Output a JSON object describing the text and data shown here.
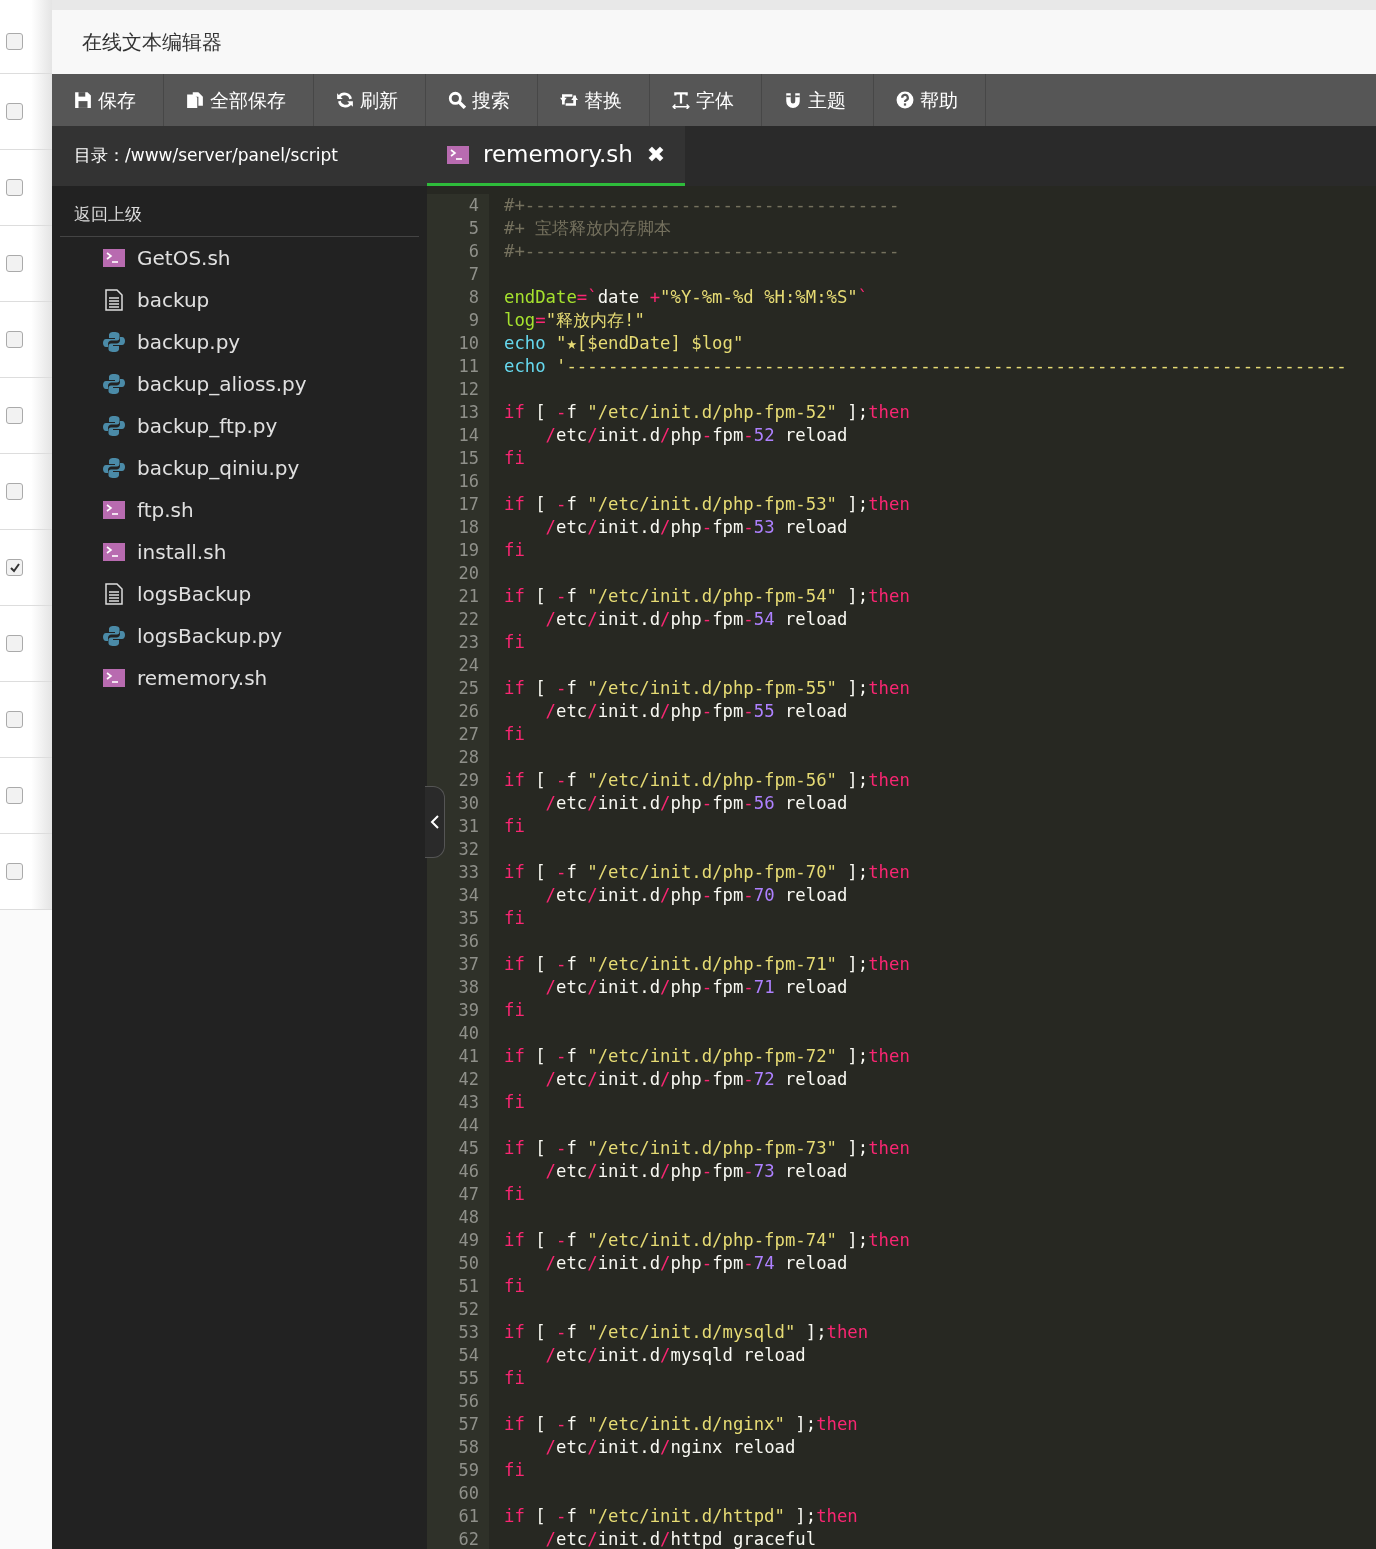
{
  "background_rows": [
    {
      "checked": false
    },
    {
      "checked": false
    },
    {
      "checked": false
    },
    {
      "checked": false
    },
    {
      "checked": false
    },
    {
      "checked": false
    },
    {
      "checked": false
    },
    {
      "checked": true
    },
    {
      "checked": false
    },
    {
      "checked": false
    },
    {
      "checked": false
    },
    {
      "checked": false
    }
  ],
  "window": {
    "title": "在线文本编辑器"
  },
  "toolbar": [
    {
      "kind": "save",
      "label": "保存"
    },
    {
      "kind": "copy",
      "label": "全部保存"
    },
    {
      "kind": "refresh",
      "label": "刷新"
    },
    {
      "kind": "search",
      "label": "搜索"
    },
    {
      "kind": "replace",
      "label": "替换"
    },
    {
      "kind": "font",
      "label": "字体"
    },
    {
      "kind": "magnet",
      "label": "主题"
    },
    {
      "kind": "help",
      "label": "帮助"
    }
  ],
  "sidebar": {
    "directory": "目录：/www/server/panel/script",
    "back": "返回上级",
    "files": [
      {
        "name": "GetOS.sh",
        "kind": "shell"
      },
      {
        "name": "backup",
        "kind": "text"
      },
      {
        "name": "backup.py",
        "kind": "python"
      },
      {
        "name": "backup_alioss.py",
        "kind": "python"
      },
      {
        "name": "backup_ftp.py",
        "kind": "python"
      },
      {
        "name": "backup_qiniu.py",
        "kind": "python"
      },
      {
        "name": "ftp.sh",
        "kind": "shell"
      },
      {
        "name": "install.sh",
        "kind": "shell"
      },
      {
        "name": "logsBackup",
        "kind": "text"
      },
      {
        "name": "logsBackup.py",
        "kind": "python"
      },
      {
        "name": "rememory.sh",
        "kind": "shell"
      }
    ]
  },
  "tabs": [
    {
      "label": "rememory.sh",
      "kind": "shell",
      "selected": true,
      "close": "✖"
    }
  ],
  "code_lines": [
    {
      "number": "4",
      "tokens": [
        {
          "text": "#+------------------------------------",
          "kind": "comment"
        }
      ]
    },
    {
      "number": "5",
      "tokens": [
        {
          "text": "#+ 宝塔释放内存脚本",
          "kind": "comment"
        }
      ]
    },
    {
      "number": "6",
      "tokens": [
        {
          "text": "#+------------------------------------",
          "kind": "comment"
        }
      ]
    },
    {
      "number": "7"
    },
    {
      "number": "8",
      "tokens": [
        {
          "text": "endDate",
          "kind": "var"
        },
        {
          "text": "=`",
          "kind": "op"
        },
        {
          "text": "date ",
          "kind": "plain"
        },
        {
          "text": "+",
          "kind": "op"
        },
        {
          "text": "\"%Y-%m-%d %H:%M:%S\"",
          "kind": "str"
        },
        {
          "text": "`",
          "kind": "op"
        }
      ]
    },
    {
      "number": "9",
      "tokens": [
        {
          "text": "log",
          "kind": "var"
        },
        {
          "text": "=",
          "kind": "op"
        },
        {
          "text": "\"释放内存!\"",
          "kind": "str"
        }
      ]
    },
    {
      "number": "10",
      "tokens": [
        {
          "text": "echo",
          "kind": "builtin"
        },
        {
          "text": " \"★[$endDate] $log\"",
          "kind": "str"
        }
      ]
    },
    {
      "number": "11",
      "tokens": [
        {
          "text": "echo",
          "kind": "builtin"
        },
        {
          "text": " '---------------------------------------------------------------------------",
          "kind": "str"
        }
      ]
    },
    {
      "number": "12"
    },
    {
      "number": "13",
      "tokens": [
        {
          "text": "if",
          "kind": "kw"
        },
        {
          "text": " [ ",
          "kind": "plain"
        },
        {
          "text": "-",
          "kind": "op"
        },
        {
          "text": "f ",
          "kind": "plain"
        },
        {
          "text": "\"/etc/init.d/php-fpm-52\"",
          "kind": "str"
        },
        {
          "text": " ];",
          "kind": "plain"
        },
        {
          "text": "then",
          "kind": "kw"
        }
      ]
    },
    {
      "number": "14",
      "tokens": [
        {
          "text": "    /",
          "kind": "op"
        },
        {
          "text": "etc",
          "kind": "plain"
        },
        {
          "text": "/",
          "kind": "op"
        },
        {
          "text": "init.d",
          "kind": "plain"
        },
        {
          "text": "/",
          "kind": "op"
        },
        {
          "text": "php",
          "kind": "plain"
        },
        {
          "text": "-",
          "kind": "op"
        },
        {
          "text": "fpm",
          "kind": "plain"
        },
        {
          "text": "-",
          "kind": "op"
        },
        {
          "text": "52",
          "kind": "num"
        },
        {
          "text": " reload",
          "kind": "plain"
        }
      ]
    },
    {
      "number": "15",
      "tokens": [
        {
          "text": "fi",
          "kind": "kw"
        }
      ]
    },
    {
      "number": "16"
    },
    {
      "number": "17",
      "tokens": [
        {
          "text": "if",
          "kind": "kw"
        },
        {
          "text": " [ ",
          "kind": "plain"
        },
        {
          "text": "-",
          "kind": "op"
        },
        {
          "text": "f ",
          "kind": "plain"
        },
        {
          "text": "\"/etc/init.d/php-fpm-53\"",
          "kind": "str"
        },
        {
          "text": " ];",
          "kind": "plain"
        },
        {
          "text": "then",
          "kind": "kw"
        }
      ]
    },
    {
      "number": "18",
      "tokens": [
        {
          "text": "    /",
          "kind": "op"
        },
        {
          "text": "etc",
          "kind": "plain"
        },
        {
          "text": "/",
          "kind": "op"
        },
        {
          "text": "init.d",
          "kind": "plain"
        },
        {
          "text": "/",
          "kind": "op"
        },
        {
          "text": "php",
          "kind": "plain"
        },
        {
          "text": "-",
          "kind": "op"
        },
        {
          "text": "fpm",
          "kind": "plain"
        },
        {
          "text": "-",
          "kind": "op"
        },
        {
          "text": "53",
          "kind": "num"
        },
        {
          "text": " reload",
          "kind": "plain"
        }
      ]
    },
    {
      "number": "19",
      "tokens": [
        {
          "text": "fi",
          "kind": "kw"
        }
      ]
    },
    {
      "number": "20"
    },
    {
      "number": "21",
      "tokens": [
        {
          "text": "if",
          "kind": "kw"
        },
        {
          "text": " [ ",
          "kind": "plain"
        },
        {
          "text": "-",
          "kind": "op"
        },
        {
          "text": "f ",
          "kind": "plain"
        },
        {
          "text": "\"/etc/init.d/php-fpm-54\"",
          "kind": "str"
        },
        {
          "text": " ];",
          "kind": "plain"
        },
        {
          "text": "then",
          "kind": "kw"
        }
      ]
    },
    {
      "number": "22",
      "tokens": [
        {
          "text": "    /",
          "kind": "op"
        },
        {
          "text": "etc",
          "kind": "plain"
        },
        {
          "text": "/",
          "kind": "op"
        },
        {
          "text": "init.d",
          "kind": "plain"
        },
        {
          "text": "/",
          "kind": "op"
        },
        {
          "text": "php",
          "kind": "plain"
        },
        {
          "text": "-",
          "kind": "op"
        },
        {
          "text": "fpm",
          "kind": "plain"
        },
        {
          "text": "-",
          "kind": "op"
        },
        {
          "text": "54",
          "kind": "num"
        },
        {
          "text": " reload",
          "kind": "plain"
        }
      ]
    },
    {
      "number": "23",
      "tokens": [
        {
          "text": "fi",
          "kind": "kw"
        }
      ]
    },
    {
      "number": "24"
    },
    {
      "number": "25",
      "tokens": [
        {
          "text": "if",
          "kind": "kw"
        },
        {
          "text": " [ ",
          "kind": "plain"
        },
        {
          "text": "-",
          "kind": "op"
        },
        {
          "text": "f ",
          "kind": "plain"
        },
        {
          "text": "\"/etc/init.d/php-fpm-55\"",
          "kind": "str"
        },
        {
          "text": " ];",
          "kind": "plain"
        },
        {
          "text": "then",
          "kind": "kw"
        }
      ]
    },
    {
      "number": "26",
      "tokens": [
        {
          "text": "    /",
          "kind": "op"
        },
        {
          "text": "etc",
          "kind": "plain"
        },
        {
          "text": "/",
          "kind": "op"
        },
        {
          "text": "init.d",
          "kind": "plain"
        },
        {
          "text": "/",
          "kind": "op"
        },
        {
          "text": "php",
          "kind": "plain"
        },
        {
          "text": "-",
          "kind": "op"
        },
        {
          "text": "fpm",
          "kind": "plain"
        },
        {
          "text": "-",
          "kind": "op"
        },
        {
          "text": "55",
          "kind": "num"
        },
        {
          "text": " reload",
          "kind": "plain"
        }
      ]
    },
    {
      "number": "27",
      "tokens": [
        {
          "text": "fi",
          "kind": "kw"
        }
      ]
    },
    {
      "number": "28"
    },
    {
      "number": "29",
      "tokens": [
        {
          "text": "if",
          "kind": "kw"
        },
        {
          "text": " [ ",
          "kind": "plain"
        },
        {
          "text": "-",
          "kind": "op"
        },
        {
          "text": "f ",
          "kind": "plain"
        },
        {
          "text": "\"/etc/init.d/php-fpm-56\"",
          "kind": "str"
        },
        {
          "text": " ];",
          "kind": "plain"
        },
        {
          "text": "then",
          "kind": "kw"
        }
      ]
    },
    {
      "number": "30",
      "tokens": [
        {
          "text": "    /",
          "kind": "op"
        },
        {
          "text": "etc",
          "kind": "plain"
        },
        {
          "text": "/",
          "kind": "op"
        },
        {
          "text": "init.d",
          "kind": "plain"
        },
        {
          "text": "/",
          "kind": "op"
        },
        {
          "text": "php",
          "kind": "plain"
        },
        {
          "text": "-",
          "kind": "op"
        },
        {
          "text": "fpm",
          "kind": "plain"
        },
        {
          "text": "-",
          "kind": "op"
        },
        {
          "text": "56",
          "kind": "num"
        },
        {
          "text": " reload",
          "kind": "plain"
        }
      ]
    },
    {
      "number": "31",
      "tokens": [
        {
          "text": "fi",
          "kind": "kw"
        }
      ]
    },
    {
      "number": "32"
    },
    {
      "number": "33",
      "tokens": [
        {
          "text": "if",
          "kind": "kw"
        },
        {
          "text": " [ ",
          "kind": "plain"
        },
        {
          "text": "-",
          "kind": "op"
        },
        {
          "text": "f ",
          "kind": "plain"
        },
        {
          "text": "\"/etc/init.d/php-fpm-70\"",
          "kind": "str"
        },
        {
          "text": " ];",
          "kind": "plain"
        },
        {
          "text": "then",
          "kind": "kw"
        }
      ]
    },
    {
      "number": "34",
      "tokens": [
        {
          "text": "    /",
          "kind": "op"
        },
        {
          "text": "etc",
          "kind": "plain"
        },
        {
          "text": "/",
          "kind": "op"
        },
        {
          "text": "init.d",
          "kind": "plain"
        },
        {
          "text": "/",
          "kind": "op"
        },
        {
          "text": "php",
          "kind": "plain"
        },
        {
          "text": "-",
          "kind": "op"
        },
        {
          "text": "fpm",
          "kind": "plain"
        },
        {
          "text": "-",
          "kind": "op"
        },
        {
          "text": "70",
          "kind": "num"
        },
        {
          "text": " reload",
          "kind": "plain"
        }
      ]
    },
    {
      "number": "35",
      "tokens": [
        {
          "text": "fi",
          "kind": "kw"
        }
      ]
    },
    {
      "number": "36"
    },
    {
      "number": "37",
      "tokens": [
        {
          "text": "if",
          "kind": "kw"
        },
        {
          "text": " [ ",
          "kind": "plain"
        },
        {
          "text": "-",
          "kind": "op"
        },
        {
          "text": "f ",
          "kind": "plain"
        },
        {
          "text": "\"/etc/init.d/php-fpm-71\"",
          "kind": "str"
        },
        {
          "text": " ];",
          "kind": "plain"
        },
        {
          "text": "then",
          "kind": "kw"
        }
      ]
    },
    {
      "number": "38",
      "tokens": [
        {
          "text": "    /",
          "kind": "op"
        },
        {
          "text": "etc",
          "kind": "plain"
        },
        {
          "text": "/",
          "kind": "op"
        },
        {
          "text": "init.d",
          "kind": "plain"
        },
        {
          "text": "/",
          "kind": "op"
        },
        {
          "text": "php",
          "kind": "plain"
        },
        {
          "text": "-",
          "kind": "op"
        },
        {
          "text": "fpm",
          "kind": "plain"
        },
        {
          "text": "-",
          "kind": "op"
        },
        {
          "text": "71",
          "kind": "num"
        },
        {
          "text": " reload",
          "kind": "plain"
        }
      ]
    },
    {
      "number": "39",
      "tokens": [
        {
          "text": "fi",
          "kind": "kw"
        }
      ]
    },
    {
      "number": "40"
    },
    {
      "number": "41",
      "tokens": [
        {
          "text": "if",
          "kind": "kw"
        },
        {
          "text": " [ ",
          "kind": "plain"
        },
        {
          "text": "-",
          "kind": "op"
        },
        {
          "text": "f ",
          "kind": "plain"
        },
        {
          "text": "\"/etc/init.d/php-fpm-72\"",
          "kind": "str"
        },
        {
          "text": " ];",
          "kind": "plain"
        },
        {
          "text": "then",
          "kind": "kw"
        }
      ]
    },
    {
      "number": "42",
      "tokens": [
        {
          "text": "    /",
          "kind": "op"
        },
        {
          "text": "etc",
          "kind": "plain"
        },
        {
          "text": "/",
          "kind": "op"
        },
        {
          "text": "init.d",
          "kind": "plain"
        },
        {
          "text": "/",
          "kind": "op"
        },
        {
          "text": "php",
          "kind": "plain"
        },
        {
          "text": "-",
          "kind": "op"
        },
        {
          "text": "fpm",
          "kind": "plain"
        },
        {
          "text": "-",
          "kind": "op"
        },
        {
          "text": "72",
          "kind": "num"
        },
        {
          "text": " reload",
          "kind": "plain"
        }
      ]
    },
    {
      "number": "43",
      "tokens": [
        {
          "text": "fi",
          "kind": "kw"
        }
      ]
    },
    {
      "number": "44"
    },
    {
      "number": "45",
      "tokens": [
        {
          "text": "if",
          "kind": "kw"
        },
        {
          "text": " [ ",
          "kind": "plain"
        },
        {
          "text": "-",
          "kind": "op"
        },
        {
          "text": "f ",
          "kind": "plain"
        },
        {
          "text": "\"/etc/init.d/php-fpm-73\"",
          "kind": "str"
        },
        {
          "text": " ];",
          "kind": "plain"
        },
        {
          "text": "then",
          "kind": "kw"
        }
      ]
    },
    {
      "number": "46",
      "tokens": [
        {
          "text": "    /",
          "kind": "op"
        },
        {
          "text": "etc",
          "kind": "plain"
        },
        {
          "text": "/",
          "kind": "op"
        },
        {
          "text": "init.d",
          "kind": "plain"
        },
        {
          "text": "/",
          "kind": "op"
        },
        {
          "text": "php",
          "kind": "plain"
        },
        {
          "text": "-",
          "kind": "op"
        },
        {
          "text": "fpm",
          "kind": "plain"
        },
        {
          "text": "-",
          "kind": "op"
        },
        {
          "text": "73",
          "kind": "num"
        },
        {
          "text": " reload",
          "kind": "plain"
        }
      ]
    },
    {
      "number": "47",
      "tokens": [
        {
          "text": "fi",
          "kind": "kw"
        }
      ]
    },
    {
      "number": "48"
    },
    {
      "number": "49",
      "tokens": [
        {
          "text": "if",
          "kind": "kw"
        },
        {
          "text": " [ ",
          "kind": "plain"
        },
        {
          "text": "-",
          "kind": "op"
        },
        {
          "text": "f ",
          "kind": "plain"
        },
        {
          "text": "\"/etc/init.d/php-fpm-74\"",
          "kind": "str"
        },
        {
          "text": " ];",
          "kind": "plain"
        },
        {
          "text": "then",
          "kind": "kw"
        }
      ]
    },
    {
      "number": "50",
      "tokens": [
        {
          "text": "    /",
          "kind": "op"
        },
        {
          "text": "etc",
          "kind": "plain"
        },
        {
          "text": "/",
          "kind": "op"
        },
        {
          "text": "init.d",
          "kind": "plain"
        },
        {
          "text": "/",
          "kind": "op"
        },
        {
          "text": "php",
          "kind": "plain"
        },
        {
          "text": "-",
          "kind": "op"
        },
        {
          "text": "fpm",
          "kind": "plain"
        },
        {
          "text": "-",
          "kind": "op"
        },
        {
          "text": "74",
          "kind": "num"
        },
        {
          "text": " reload",
          "kind": "plain"
        }
      ]
    },
    {
      "number": "51",
      "tokens": [
        {
          "text": "fi",
          "kind": "kw"
        }
      ]
    },
    {
      "number": "52"
    },
    {
      "number": "53",
      "tokens": [
        {
          "text": "if",
          "kind": "kw"
        },
        {
          "text": " [ ",
          "kind": "plain"
        },
        {
          "text": "-",
          "kind": "op"
        },
        {
          "text": "f ",
          "kind": "plain"
        },
        {
          "text": "\"/etc/init.d/mysqld\"",
          "kind": "str"
        },
        {
          "text": " ];",
          "kind": "plain"
        },
        {
          "text": "then",
          "kind": "kw"
        }
      ]
    },
    {
      "number": "54",
      "tokens": [
        {
          "text": "    /",
          "kind": "op"
        },
        {
          "text": "etc",
          "kind": "plain"
        },
        {
          "text": "/",
          "kind": "op"
        },
        {
          "text": "init.d",
          "kind": "plain"
        },
        {
          "text": "/",
          "kind": "op"
        },
        {
          "text": "mysqld reload",
          "kind": "plain"
        }
      ]
    },
    {
      "number": "55",
      "tokens": [
        {
          "text": "fi",
          "kind": "kw"
        }
      ]
    },
    {
      "number": "56"
    },
    {
      "number": "57",
      "tokens": [
        {
          "text": "if",
          "kind": "kw"
        },
        {
          "text": " [ ",
          "kind": "plain"
        },
        {
          "text": "-",
          "kind": "op"
        },
        {
          "text": "f ",
          "kind": "plain"
        },
        {
          "text": "\"/etc/init.d/nginx\"",
          "kind": "str"
        },
        {
          "text": " ];",
          "kind": "plain"
        },
        {
          "text": "then",
          "kind": "kw"
        }
      ]
    },
    {
      "number": "58",
      "tokens": [
        {
          "text": "    /",
          "kind": "op"
        },
        {
          "text": "etc",
          "kind": "plain"
        },
        {
          "text": "/",
          "kind": "op"
        },
        {
          "text": "init.d",
          "kind": "plain"
        },
        {
          "text": "/",
          "kind": "op"
        },
        {
          "text": "nginx reload",
          "kind": "plain"
        }
      ]
    },
    {
      "number": "59",
      "tokens": [
        {
          "text": "fi",
          "kind": "kw"
        }
      ]
    },
    {
      "number": "60"
    },
    {
      "number": "61",
      "tokens": [
        {
          "text": "if",
          "kind": "kw"
        },
        {
          "text": " [ ",
          "kind": "plain"
        },
        {
          "text": "-",
          "kind": "op"
        },
        {
          "text": "f ",
          "kind": "plain"
        },
        {
          "text": "\"/etc/init.d/httpd\"",
          "kind": "str"
        },
        {
          "text": " ];",
          "kind": "plain"
        },
        {
          "text": "then",
          "kind": "kw"
        }
      ]
    },
    {
      "number": "62",
      "tokens": [
        {
          "text": "    /",
          "kind": "op"
        },
        {
          "text": "etc",
          "kind": "plain"
        },
        {
          "text": "/",
          "kind": "op"
        },
        {
          "text": "init.d",
          "kind": "plain"
        },
        {
          "text": "/",
          "kind": "op"
        },
        {
          "text": "httpd graceful",
          "kind": "plain"
        }
      ]
    }
  ]
}
